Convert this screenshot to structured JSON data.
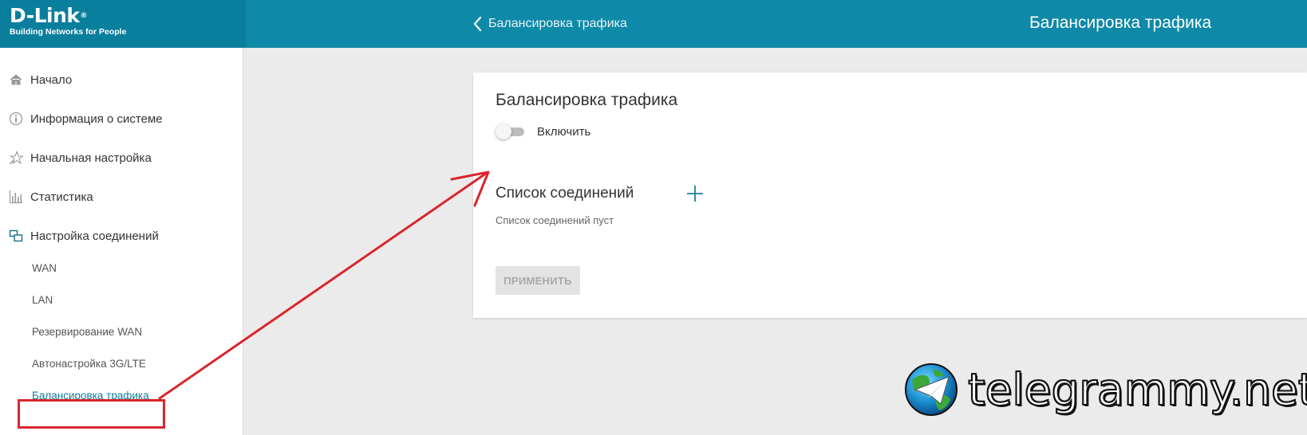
{
  "header": {
    "logo": "D-Link",
    "logo_tagline": "Building Networks for People",
    "breadcrumb": "Балансировка трафика",
    "title": "Балансировка трафика",
    "colors": {
      "bar": "#0f89a8",
      "logo_area": "#0a7f9d"
    }
  },
  "sidebar": {
    "items": [
      {
        "label": "Начало",
        "icon": "home-icon"
      },
      {
        "label": "Информация о системе",
        "icon": "info-icon"
      },
      {
        "label": "Начальная настройка",
        "icon": "wizard-star-icon"
      },
      {
        "label": "Статистика",
        "icon": "bar-chart-icon"
      },
      {
        "label": "Настройка соединений",
        "icon": "connections-icon"
      }
    ],
    "subitems": [
      {
        "label": "WAN"
      },
      {
        "label": "LAN"
      },
      {
        "label": "Резервирование WAN"
      },
      {
        "label": "Автонастройка 3G/LTE"
      },
      {
        "label": "Балансировка трафика",
        "active": true
      }
    ]
  },
  "card": {
    "title": "Балансировка трафика",
    "toggle_label": "Включить",
    "toggle_on": false,
    "list_title": "Список соединений",
    "list_empty": "Список соединений пуст",
    "apply_label": "ПРИМЕНИТЬ"
  },
  "annotation": {
    "color": "#d9262c"
  },
  "watermark": {
    "text": "telegrammy.net"
  }
}
